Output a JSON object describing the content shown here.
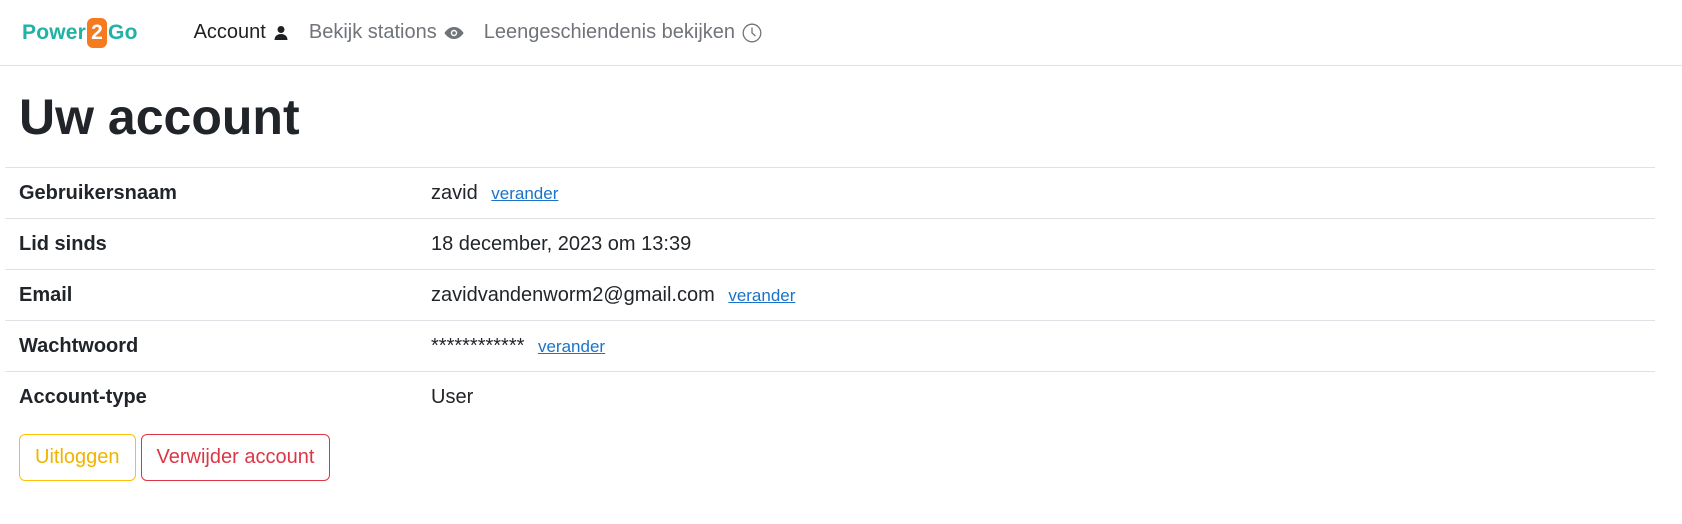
{
  "brand": {
    "part1": "Power",
    "part2": "2",
    "part3": "Go"
  },
  "nav": {
    "account": {
      "label": "Account",
      "icon": "person-icon"
    },
    "stations": {
      "label": "Bekijk stations",
      "icon": "eye-icon"
    },
    "history": {
      "label": "Leengeschiendenis bekijken",
      "icon": "clock-icon"
    }
  },
  "page": {
    "title": "Uw account"
  },
  "rows": [
    {
      "label": "Gebruikersnaam",
      "value": "zavid",
      "action": "verander"
    },
    {
      "label": "Lid sinds",
      "value": "18 december, 2023 om 13:39",
      "action": null
    },
    {
      "label": "Email",
      "value": "zavidvandenworm2@gmail.com",
      "action": "verander"
    },
    {
      "label": "Wachtwoord",
      "value": "************",
      "action": "verander"
    },
    {
      "label": "Account-type",
      "value": "User",
      "action": null
    }
  ],
  "buttons": {
    "logout": "Uitloggen",
    "delete": "Verwijder account"
  },
  "colors": {
    "brand": "#20b2a5",
    "brand_accent": "#f47b20",
    "logout": "#ffc107",
    "delete": "#dc3545",
    "link": "#1a73c8"
  }
}
